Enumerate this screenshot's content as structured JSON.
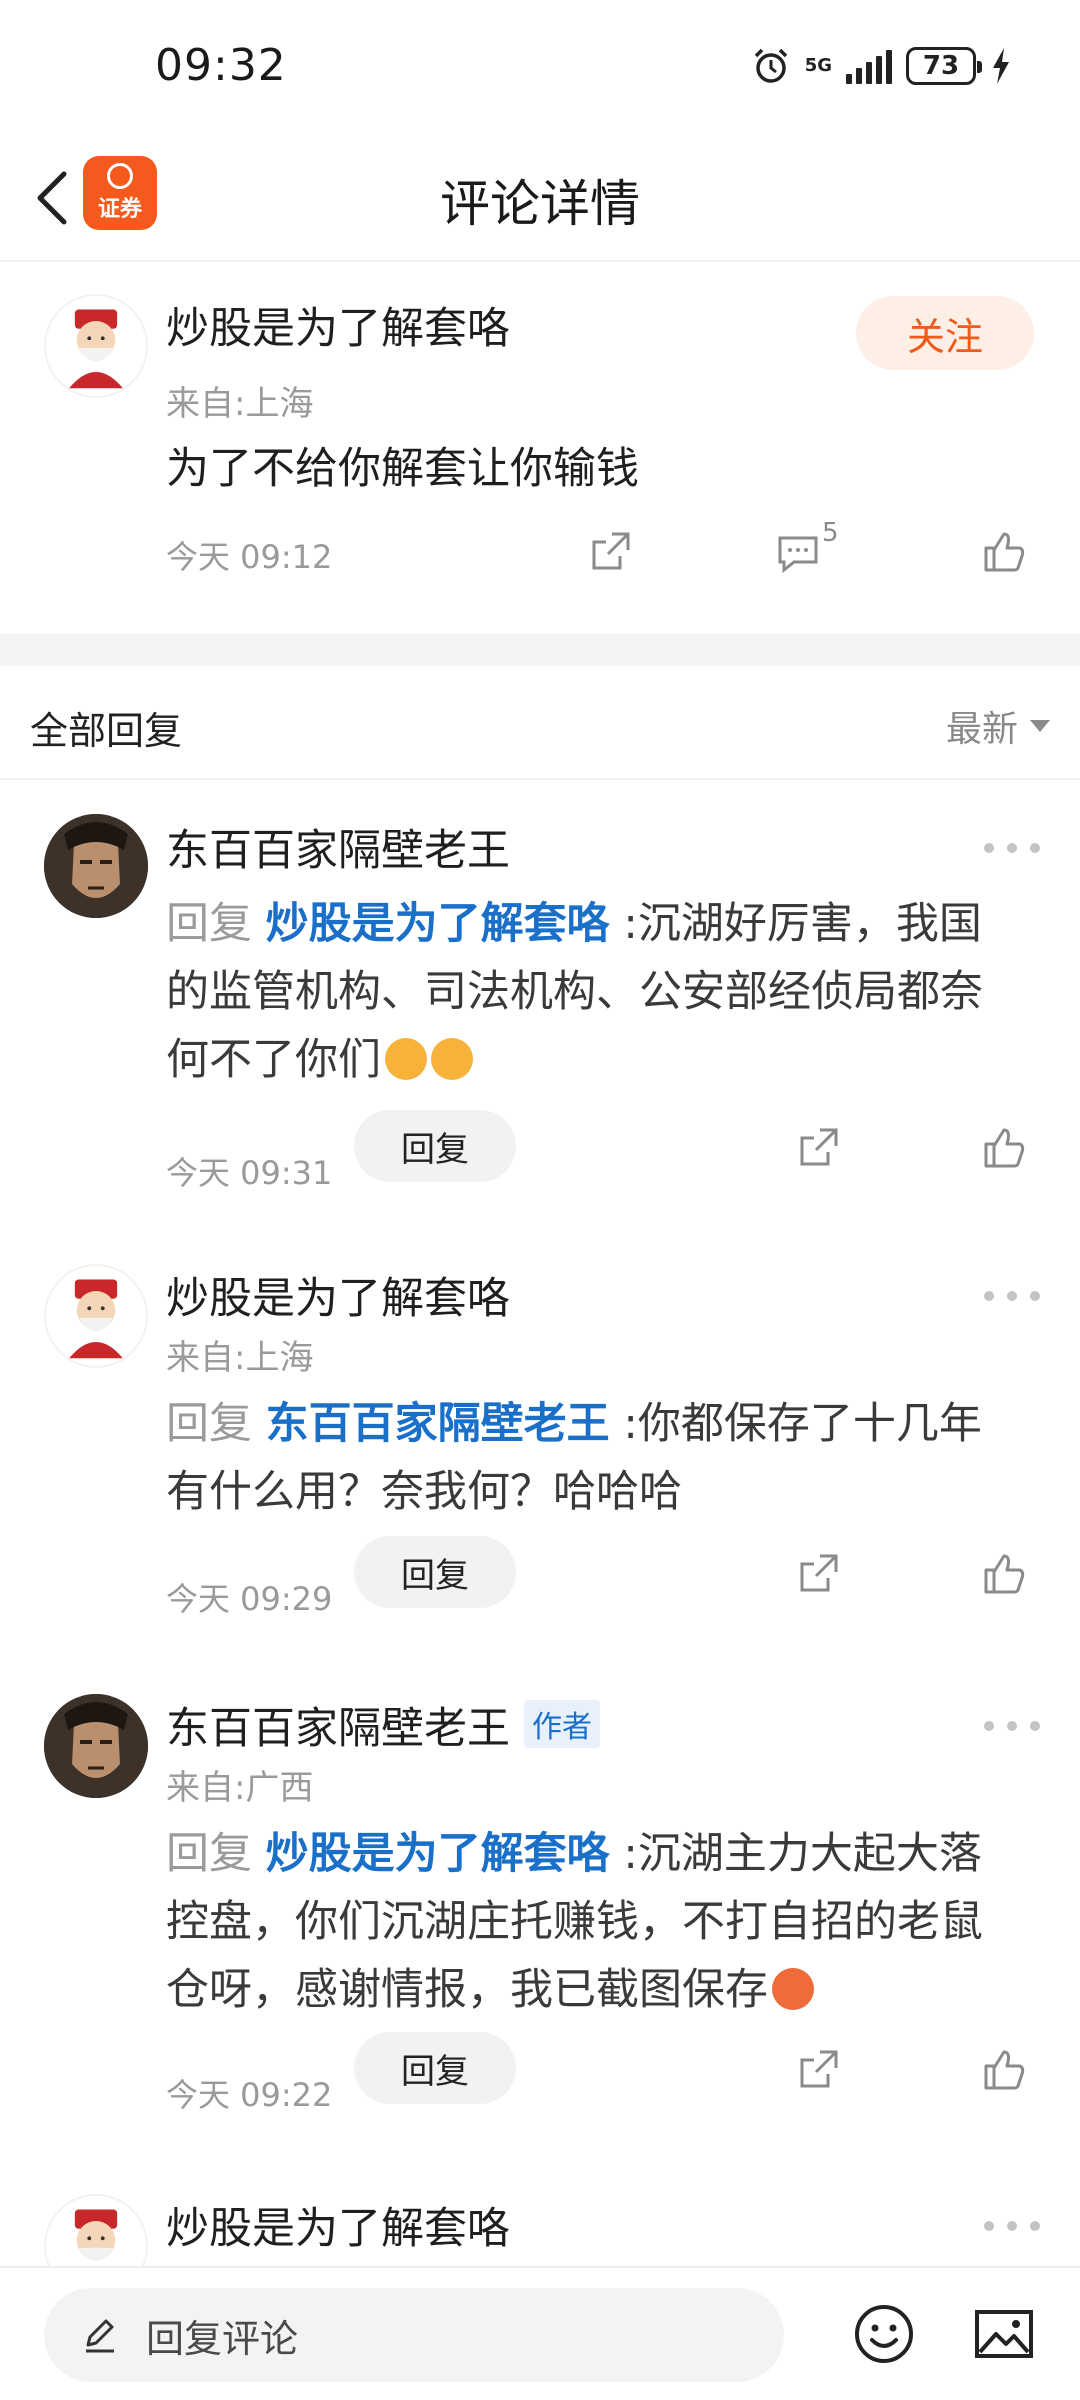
{
  "status_bar": {
    "time": "09:32",
    "network": "5G",
    "battery": "73"
  },
  "header": {
    "title": "评论详情",
    "logo_text": "证券"
  },
  "main_comment": {
    "username": "炒股是为了解套咯",
    "location": "来自:上海",
    "text": "为了不给你解套让你输钱",
    "time": "今天 09:12",
    "comment_count": "5",
    "follow_label": "关注"
  },
  "replies_header": {
    "label": "全部回复",
    "sort": "最新"
  },
  "replies": [
    {
      "username": "东百百家隔壁老王",
      "reply_prefix": "回复",
      "mention": "炒股是为了解套咯",
      "separator": ":",
      "lines": [
        "沉湖好厉害，我国",
        "的监管机构、司法机构、公安部经侦局都奈",
        "何不了你们"
      ],
      "time": "今天 09:31",
      "reply_label": "回复"
    },
    {
      "username": "炒股是为了解套咯",
      "location": "来自:上海",
      "reply_prefix": "回复",
      "mention": "东百百家隔壁老王",
      "separator": ":",
      "lines": [
        "你都保存了十几年",
        "有什么用？奈我何？哈哈哈"
      ],
      "time": "今天 09:29",
      "reply_label": "回复"
    },
    {
      "username": "东百百家隔壁老王",
      "tag": "作者",
      "location": "来自:广西",
      "reply_prefix": "回复",
      "mention": "炒股是为了解套咯",
      "separator": ":",
      "lines": [
        "沉湖主力大起大落",
        "控盘，你们沉湖庄托赚钱，不打自招的老鼠",
        "仓呀，感谢情报，我已截图保存"
      ],
      "time": "今天 09:22",
      "reply_label": "回复"
    },
    {
      "username": "炒股是为了解套咯"
    }
  ],
  "bottom_bar": {
    "placeholder": "回复评论"
  },
  "colors": {
    "accent": "#f05a1a",
    "mention": "#1a6fc9",
    "muted": "#9a9a9a"
  }
}
